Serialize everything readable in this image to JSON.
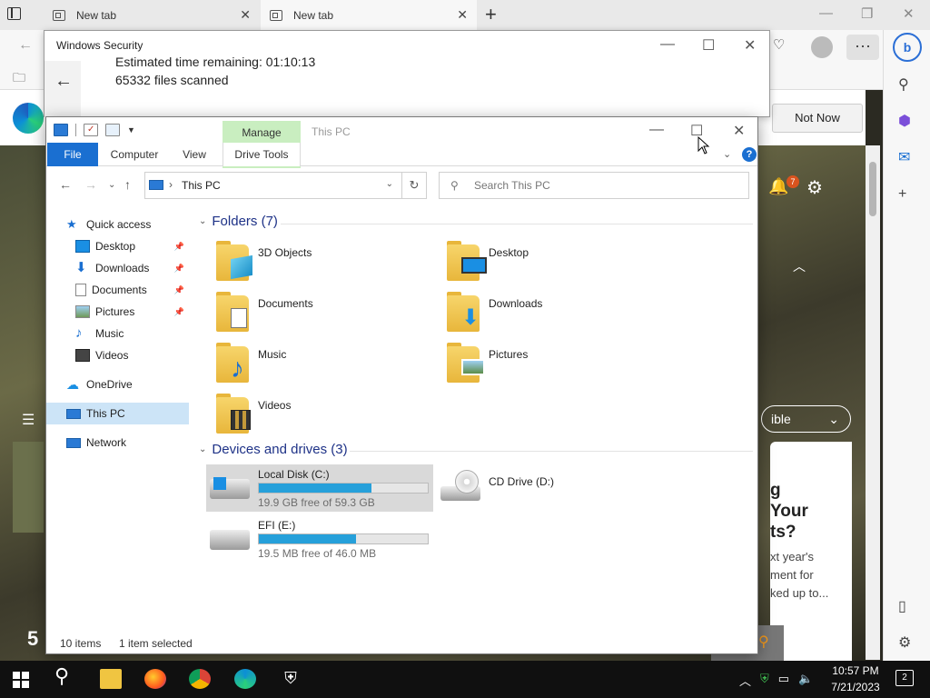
{
  "browser": {
    "tabs": [
      {
        "label": "New tab"
      },
      {
        "label": "New tab"
      }
    ],
    "new_tab_symbol": "+",
    "not_now_label": "Not Now",
    "notification_count": "7",
    "visible_pill": "ible",
    "news": {
      "headline_lines": [
        "g",
        "Your",
        "ts?"
      ],
      "body_lines": [
        "xt year's",
        "ment for",
        "ked up to..."
      ]
    },
    "left_number": "5"
  },
  "windows_security": {
    "title": "Windows Security",
    "eta": "Estimated time remaining: 01:10:13",
    "files_scanned": "65332  files scanned"
  },
  "explorer": {
    "title": "This PC",
    "manage_tab": "Manage",
    "ribbon_tabs": {
      "file": "File",
      "computer": "Computer",
      "view": "View",
      "drive_tools": "Drive Tools"
    },
    "address": "This PC",
    "search_placeholder": "Search This PC",
    "nav_pane": {
      "quick_access": "Quick access",
      "desktop": "Desktop",
      "downloads": "Downloads",
      "documents": "Documents",
      "pictures": "Pictures",
      "music": "Music",
      "videos": "Videos",
      "onedrive": "OneDrive",
      "this_pc": "This PC",
      "network": "Network"
    },
    "folders_header": "Folders (7)",
    "folders": [
      {
        "label": "3D Objects"
      },
      {
        "label": "Desktop"
      },
      {
        "label": "Documents"
      },
      {
        "label": "Downloads"
      },
      {
        "label": "Music"
      },
      {
        "label": "Pictures"
      },
      {
        "label": "Videos"
      }
    ],
    "drives_header": "Devices and drives (3)",
    "drives": [
      {
        "name": "Local Disk (C:)",
        "free_text": "19.9 GB free of 59.3 GB",
        "used_fraction": 0.664
      },
      {
        "name": "CD Drive (D:)"
      },
      {
        "name": "EFI (E:)",
        "free_text": "19.5 MB free of 46.0 MB",
        "used_fraction": 0.576
      }
    ],
    "status": {
      "items": "10 items",
      "selected": "1 item selected"
    }
  },
  "taskbar": {
    "time": "10:57 PM",
    "date": "7/21/2023",
    "notifications": "2"
  }
}
